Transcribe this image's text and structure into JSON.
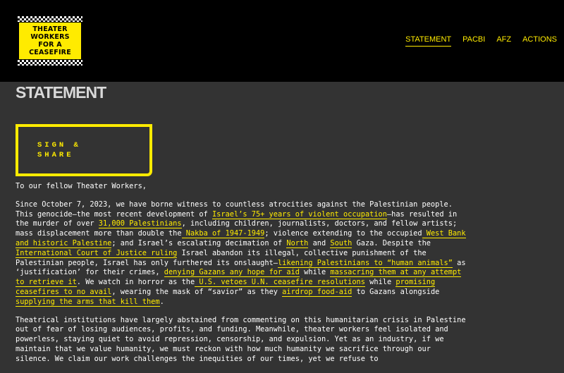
{
  "logo": {
    "lines": [
      "THEATER",
      "WORKERS",
      "FOR A",
      "CEASEFIRE"
    ]
  },
  "nav": {
    "items": [
      "STATEMENT",
      "PACBI",
      "AFZ",
      "ACTIONS"
    ]
  },
  "page_title": "STATEMENT",
  "sign_share": {
    "line1": "SIGN &",
    "line2": "SHARE"
  },
  "greeting": "To our fellow Theater Workers,",
  "para1": {
    "t1": "Since October 7, 2023, we have borne witness to countless atrocities against the Palestinian people. This genocide—the most recent development of ",
    "l1": "Israel’s 75+ years of violent occupation",
    "t2": "—has resulted in the murder of over ",
    "l2": "31,000 Palestinians",
    "t3": ", including children, journalists, doctors, and fellow artists; mass displacement more than double the",
    "l3": " Nakba of 1947-1949",
    "t4": "; violence extending to the occupied",
    "l4": " West Bank and historic Palestine",
    "t5": "; and Israel’s escalating decimation of ",
    "l5": "North",
    "t6": " and ",
    "l6": "South",
    "t7": " Gaza. Despite the ",
    "l7": "International Court of Justice ruling",
    "t8": " Israel abandon its illegal, collective punishment of the Palestinian people, Israel has only furthered its onslaught—",
    "l8": "likening Palestinians to “human animals”",
    "t9": " as ‘justification’ for their crimes, ",
    "l9": "denying Gazans any hope for aid",
    "t10": " while ",
    "l10": "massacring them at any attempt to retrieve it",
    "t11": ". We watch in horror as the",
    "l11": " U.S. vetoes U.N. ceasefire resolutions",
    "t12": " while ",
    "l12": "promising ceasefires to no avail",
    "t13": ", wearing the mask of “savior” as they ",
    "l13": "airdrop food-aid",
    "t14": " to Gazans alongside ",
    "l14": "supplying the arms that kill them",
    "t15": "."
  },
  "para2": "Theatrical institutions have largely abstained from commenting on this humanitarian crisis in Palestine out of fear of losing audiences, profits, and funding. Meanwhile, theater workers feel isolated and powerless, staying quiet to avoid repression, censorship, and expulsion. Yet as an industry, if we maintain that we value humanity, we must reckon with how much humanity we sacrifice through our silence. We claim our work challenges the inequities of our times, yet we refuse to"
}
